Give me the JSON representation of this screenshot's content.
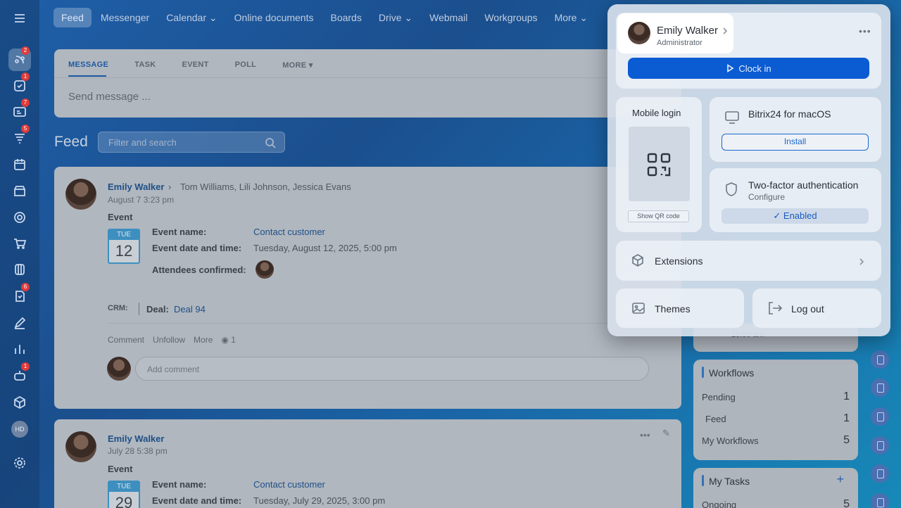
{
  "nav": {
    "items": [
      "Feed",
      "Messenger",
      "Calendar",
      "Online documents",
      "Boards",
      "Drive",
      "Webmail",
      "Workgroups",
      "More"
    ]
  },
  "sidebar": {
    "badges": {
      "feed": "2",
      "tasks": "1",
      "crm": "7",
      "filters": "5",
      "docs": "6",
      "bot": "1"
    },
    "avatar_initials": "HD"
  },
  "composer": {
    "tabs": [
      "MESSAGE",
      "TASK",
      "EVENT",
      "POLL",
      "MORE"
    ],
    "placeholder": "Send message ..."
  },
  "feed": {
    "title": "Feed",
    "search_placeholder": "Filter and search",
    "posts": [
      {
        "author": "Emily Walker",
        "recipients": "Tom Williams, Lili Johnson, Jessica Evans",
        "date": "August 7 3:23 pm",
        "type": "Event",
        "cal_dow": "TUE",
        "cal_day": "12",
        "event_name_label": "Event name:",
        "event_name": "Contact customer",
        "event_date_label": "Event date and time:",
        "event_date": "Tuesday, August 12, 2025, 5:00 pm",
        "attendees_label": "Attendees confirmed:",
        "crm_label": "CRM:",
        "deal_label": "Deal:",
        "deal_value": "Deal 94",
        "actions": [
          "Comment",
          "Unfollow",
          "More"
        ],
        "views": "1",
        "comment_placeholder": "Add comment"
      },
      {
        "author": "Emily Walker",
        "date": "July 28 5:38 pm",
        "type": "Event",
        "cal_dow": "TUE",
        "cal_day": "29",
        "event_name_label": "Event name:",
        "event_name": "Contact customer",
        "event_date_label": "Event date and time:",
        "event_date": "Tuesday, July 29, 2025, 3:00 pm"
      }
    ]
  },
  "widgets": {
    "partial_text": "10:00 am",
    "workflows": {
      "title": "Workflows",
      "rows": [
        {
          "label": "Pending",
          "count": "1"
        },
        {
          "label": "Feed",
          "count": "1"
        },
        {
          "label": "My Workflows",
          "count": "5"
        }
      ]
    },
    "tasks": {
      "title": "My Tasks",
      "add": "+",
      "rows": [
        {
          "label": "Ongoing",
          "count": "5"
        }
      ]
    }
  },
  "profile": {
    "name": "Emily Walker",
    "role": "Administrator",
    "more": "•••",
    "clock_in": "Clock in",
    "mobile_login": "Mobile login",
    "show_qr": "Show QR code",
    "mac_app": "Bitrix24 for macOS",
    "install": "Install",
    "two_factor": "Two-factor authentication",
    "configure": "Configure",
    "enabled": "Enabled",
    "extensions": "Extensions",
    "themes": "Themes",
    "logout": "Log out"
  }
}
